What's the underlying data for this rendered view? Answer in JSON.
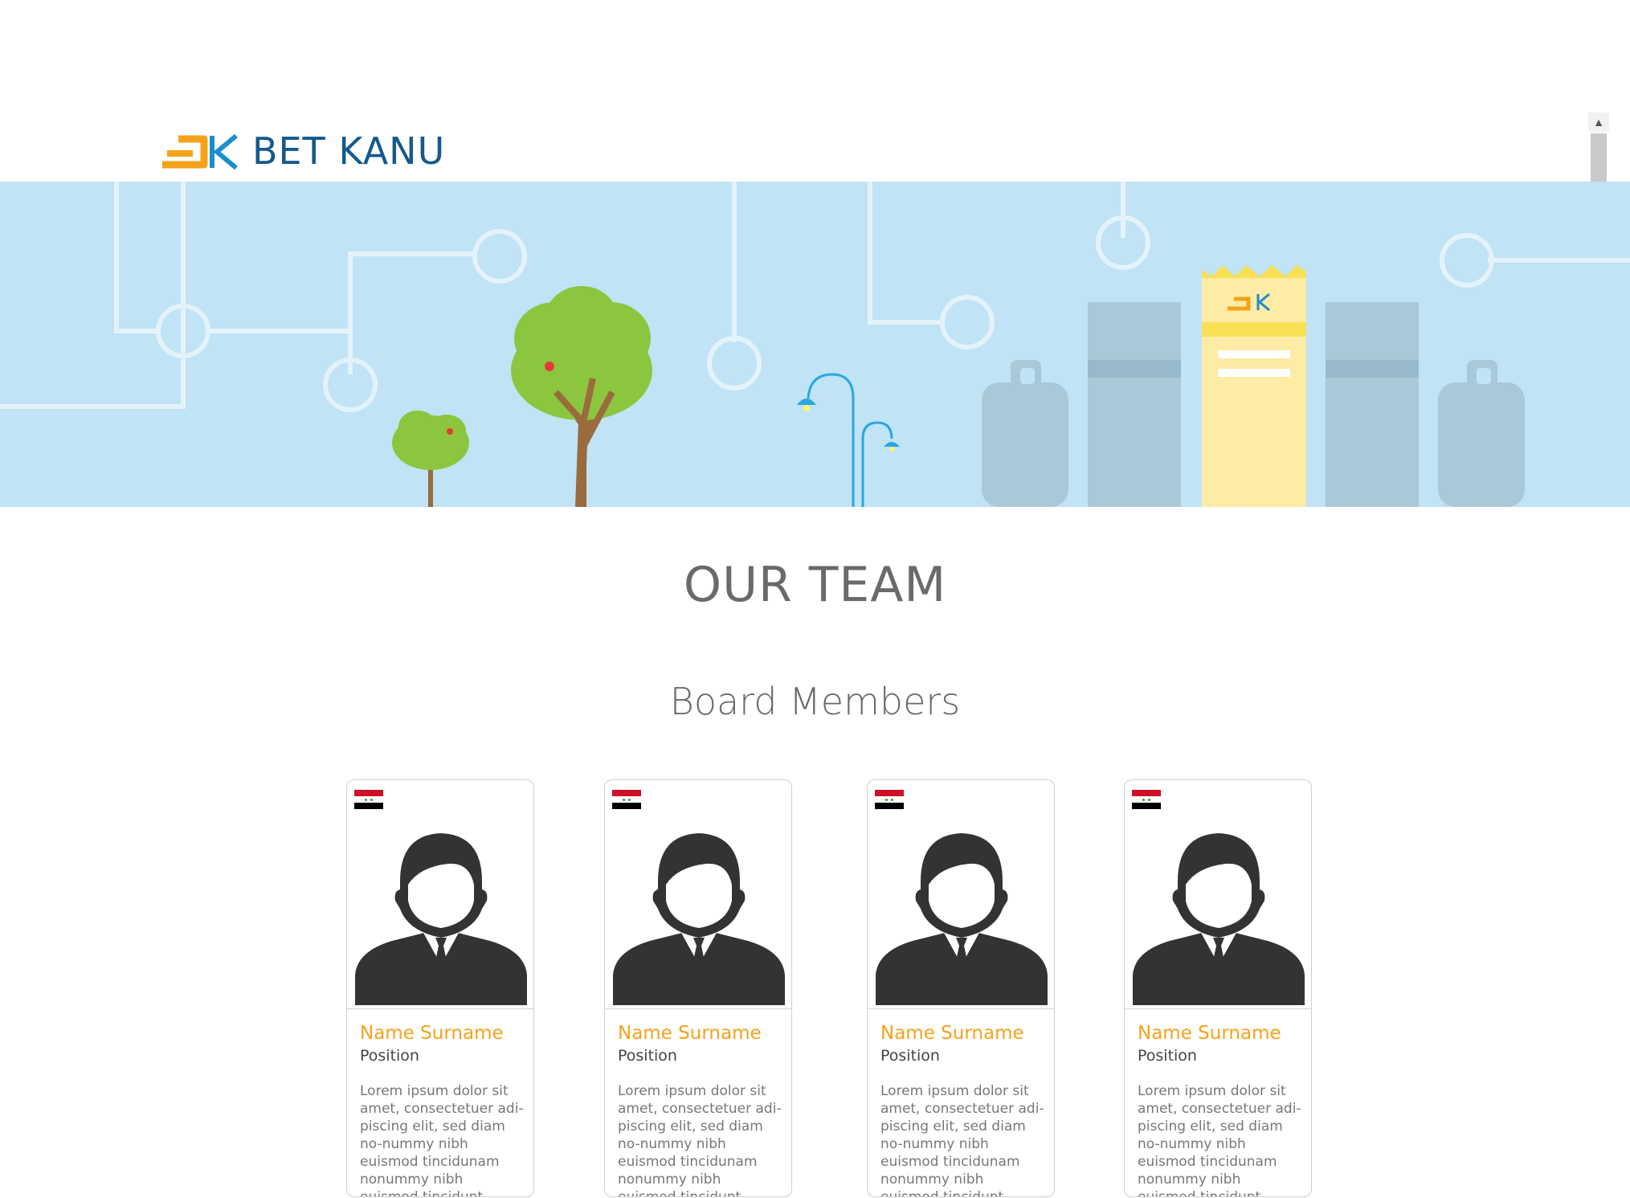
{
  "header": {
    "logo_text": "BET KANU",
    "scroll_up_icon": "▲"
  },
  "banner": {
    "building_logo_icon": "bet-kanu-logo-icon"
  },
  "main": {
    "title": "OUR TEAM",
    "subtitle": "Board Members"
  },
  "members": [
    {
      "name": "Name Surname",
      "position": "Position",
      "bio": "Lorem ipsum dolor sit amet, consectetuer adi-piscing elit, sed diam no-nummy nibh euismod tincidunam nonummy nibh euismod tincidunt"
    },
    {
      "name": "Name Surname",
      "position": "Position",
      "bio": "Lorem ipsum dolor sit amet, consectetuer adi-piscing elit, sed diam no-nummy nibh euismod tincidunam nonummy nibh euismod tincidunt"
    },
    {
      "name": "Name Surname",
      "position": "Position",
      "bio": "Lorem ipsum dolor sit amet, consectetuer adi-piscing elit, sed diam no-nummy nibh euismod tincidunam nonummy nibh euismod tincidunt"
    },
    {
      "name": "Name Surname",
      "position": "Position",
      "bio": "Lorem ipsum dolor sit amet, consectetuer adi-piscing elit, sed diam no-nummy nibh euismod tincidunam nonummy nibh euismod tincidunt"
    }
  ],
  "colors": {
    "brand_blue": "#145a8c",
    "brand_orange": "#f5a21b",
    "banner_sky": "#c0e3f5",
    "text_gray": "#6a6a6a"
  }
}
